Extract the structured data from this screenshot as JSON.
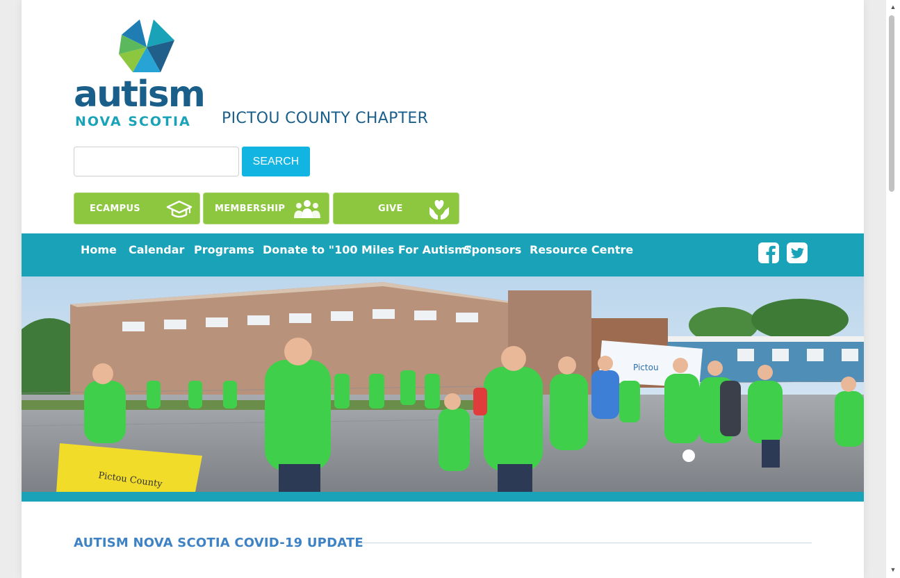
{
  "colors": {
    "brand_blue": "#1a5f8a",
    "teal": "#1aa3b8",
    "search_button": "#12b5e2",
    "quick_green": "#8dc63f",
    "heading_blue": "#3d82c4",
    "rule": "#c9d9ea"
  },
  "header": {
    "logo_word": "autism",
    "logo_sub": "NOVA SCOTIA",
    "chapter": "PICTOU COUNTY CHAPTER"
  },
  "search": {
    "value": "",
    "placeholder": "",
    "button_label": "SEARCH"
  },
  "quick_links": [
    {
      "label": "ECAMPUS",
      "icon": "graduation-cap-icon"
    },
    {
      "label": "MEMBERSHIP",
      "icon": "people-group-icon"
    },
    {
      "label": "GIVE",
      "icon": "heart-hands-icon"
    }
  ],
  "nav": {
    "items": [
      {
        "label": "Home"
      },
      {
        "label": "Calendar"
      },
      {
        "label": "Programs"
      },
      {
        "label": "Donate to \"100 Miles For Autism\""
      },
      {
        "label": "Sponsors"
      },
      {
        "label": "Resource Centre"
      }
    ],
    "social": [
      "facebook-icon",
      "twitter-icon"
    ]
  },
  "hero": {
    "banner_text": "Pictou County"
  },
  "section": {
    "title": "AUTISM NOVA SCOTIA COVID-19 UPDATE"
  }
}
